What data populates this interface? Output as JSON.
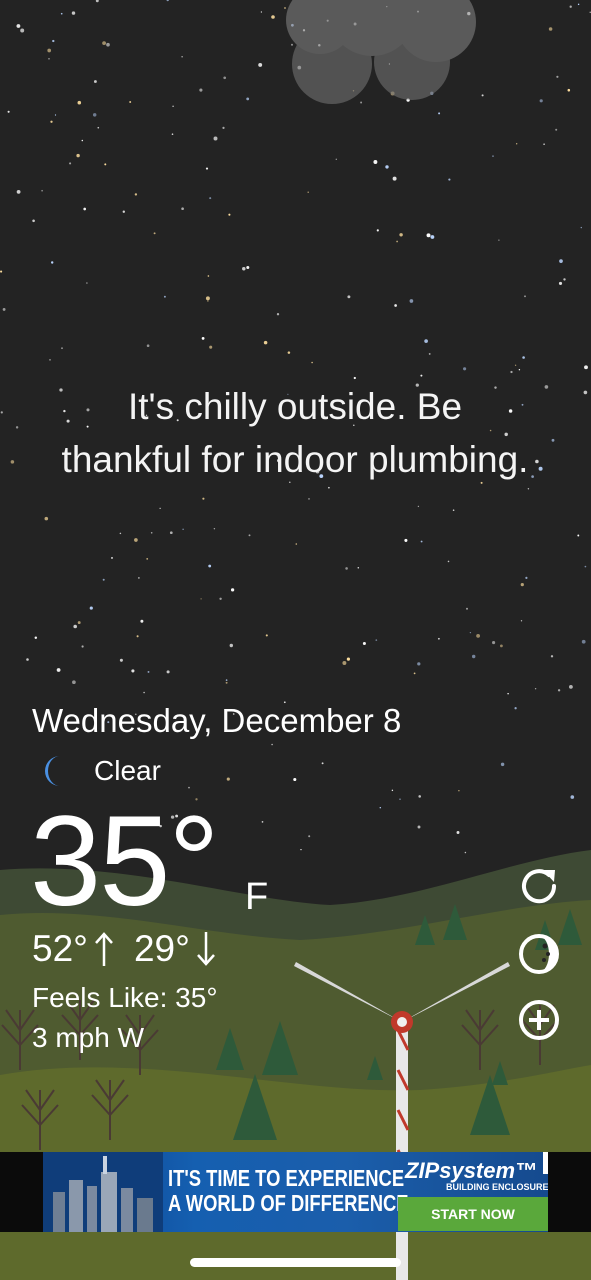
{
  "message": "It's chilly outside. Be thankful for indoor plumbing.",
  "date": "Wednesday, December 8",
  "condition": {
    "icon": "moon-icon",
    "text": "Clear",
    "icon_color": "#4a90e2"
  },
  "temperature": {
    "value": "35°",
    "unit": "F"
  },
  "high": "52°",
  "low": "29°",
  "feels_like": "Feels Like: 35°",
  "wind": "3 mph W",
  "side_actions": [
    "refresh-icon",
    "theme-icon",
    "add-icon"
  ],
  "ad": {
    "headline_line1": "IT'S TIME TO EXPERIENCE",
    "headline_line2": "A WORLD OF DIFFERENCE.",
    "brand": "ZIPsystem™",
    "brand_sub": "BUILDING ENCLOSURES",
    "cta": "START NOW",
    "brand_color": "#1b5eab",
    "cta_color": "#5aa83b"
  },
  "colors": {
    "sky": "#222222",
    "hills": "#5e6a2c",
    "text": "#ffffff"
  }
}
